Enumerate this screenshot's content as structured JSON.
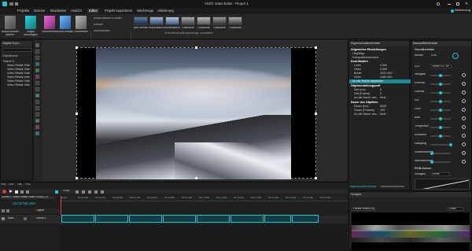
{
  "window": {
    "title": "VSDC Video Editor - Project 1",
    "accent": "#1ec6d0"
  },
  "titlebar": {
    "activation_label": "Aktivierung",
    "menus": [
      "Projekte",
      "Szenen",
      "Bearbeiten",
      "Ansicht",
      "Editor",
      "Projekt exportieren",
      "Werkzeuge",
      "Aktivierung"
    ]
  },
  "ribbon": {
    "buttons": [
      {
        "label": "Ausschneiden starten",
        "icon": "cut-start-icon"
      },
      {
        "label": "Objekt hinzufügen",
        "icon": "add-object-icon"
      },
      {
        "label": "Videoeffekte",
        "icon": "video-effects-icon"
      },
      {
        "label": "Audio-effekte",
        "icon": "audio-effects-icon"
      },
      {
        "label": "Texteffekte",
        "icon": "text-effects-icon"
      }
    ],
    "group_edit": "Bearbeitung",
    "group_tools": "Werkzeuge",
    "tools": [
      "Ausschneiden & teilen",
      "Drehen",
      "Zuschneiden"
    ],
    "templates": [
      "Alte Effekte",
      "Automatisch",
      "Automatisch",
      "Graustufe",
      "Graustufe",
      "Graustufe",
      "Graustufe"
    ],
    "group_templates": "Schnellbearbeitungsvorlage auswählen"
  },
  "explorer": {
    "title": "Objekt Expl...",
    "tab": "Objektbaum",
    "items": [
      "Szene 0",
      "Video Réalis Vide",
      "Video Réalis Vide",
      "Video Réalis Vide",
      "Video Réalis Vide",
      "Video Réalis Vide",
      "Video Réalis Vide"
    ]
  },
  "properties": {
    "title": "Eigenschaftenfenster",
    "sections": [
      {
        "text": "Allgemeine Einstellungen",
        "type": "hdr"
      },
      {
        "text": "Objekttyp",
        "value": "Video",
        "type": "row"
      },
      {
        "text": "Kompositionsmodus",
        "value": "Standard",
        "type": "row"
      },
      {
        "text": "Koordinaten",
        "type": "hdr"
      },
      {
        "text": "Links",
        "value": "0.000",
        "type": "row"
      },
      {
        "text": "Oben",
        "value": "0.000",
        "type": "row"
      },
      {
        "text": "Breite",
        "value": "1920.000",
        "type": "row"
      },
      {
        "text": "Höhe",
        "value": "1080.000",
        "type": "row"
      },
      {
        "text": "An die Szene anpassen",
        "type": "sel"
      },
      {
        "text": "Objekterstellungszeit",
        "type": "hdr"
      },
      {
        "text": "Zeit (ms)",
        "value": "0",
        "type": "row"
      },
      {
        "text": "Zeit (Frame)",
        "value": "0",
        "type": "row"
      },
      {
        "text": "An die Dauer des...",
        "value": "Nein",
        "type": "row"
      },
      {
        "text": "Dauer des Objektes",
        "type": "hdr"
      },
      {
        "text": "Dauer (ms)",
        "value": "5000",
        "type": "row"
      },
      {
        "text": "Dauer (Frames)",
        "value": "150",
        "type": "row"
      },
      {
        "text": "An die Dauer des...",
        "value": "Nein",
        "type": "row"
      }
    ],
    "tab1": "Eigenschaftenfenster",
    "tab2": "Ressourcenfenster"
  },
  "effects": {
    "title": "Basiseffektfenster",
    "basic": "Grundkorrektur",
    "lut_label": "LUT",
    "lut_value": "Keine LUT ve",
    "sliders": [
      {
        "label": "Helligkeit",
        "value": "0"
      },
      {
        "label": "Kontrast",
        "value": "0"
      },
      {
        "label": "Gamma",
        "value": "0"
      },
      {
        "label": "Rot",
        "value": "0"
      },
      {
        "label": "Grün",
        "value": "0"
      },
      {
        "label": "Blau",
        "value": "0"
      },
      {
        "label": "Temperatur",
        "value": "0"
      },
      {
        "label": "Einfärben",
        "value": "0"
      },
      {
        "label": "Sättigung",
        "value": "100"
      },
      {
        "label": "Scharfzeichnen",
        "value": "0"
      },
      {
        "label": "Weichzeichnen",
        "value": "0"
      }
    ],
    "curves": "RGB-Kurven",
    "templates_label": "Vorlagen",
    "templates_value": "Keine",
    "angle_label": "Winkel",
    "angle_value": "0.00"
  },
  "timeline": {
    "tabs": [
      "Proj...",
      "Vorl...",
      "Obj...",
      "Proj..."
    ],
    "time": "00:00:00.000",
    "zoom": "100p",
    "scene_tab": "Szene 0",
    "video_tab": "Video Réalis Video 203852_5...",
    "layer_label": "Layers",
    "track_label": "Mich...",
    "track_name": "Ebene 1",
    "clip_count": 10,
    "ruler": [
      "00:00",
      "00:01.600",
      "00:03.200",
      "00:04.800",
      "00:06.400",
      "00:08.000",
      "00:09.600",
      "00:11.200",
      "00:12.800",
      "00:14.400",
      "00:16.000",
      "00:17.600",
      "00:19.200",
      "00:20.800",
      "00:22.400",
      "00:24.000"
    ]
  },
  "scopes": {
    "title": "Scopes",
    "mode": "Parade Wellen (B)",
    "scale": "Grafik"
  }
}
